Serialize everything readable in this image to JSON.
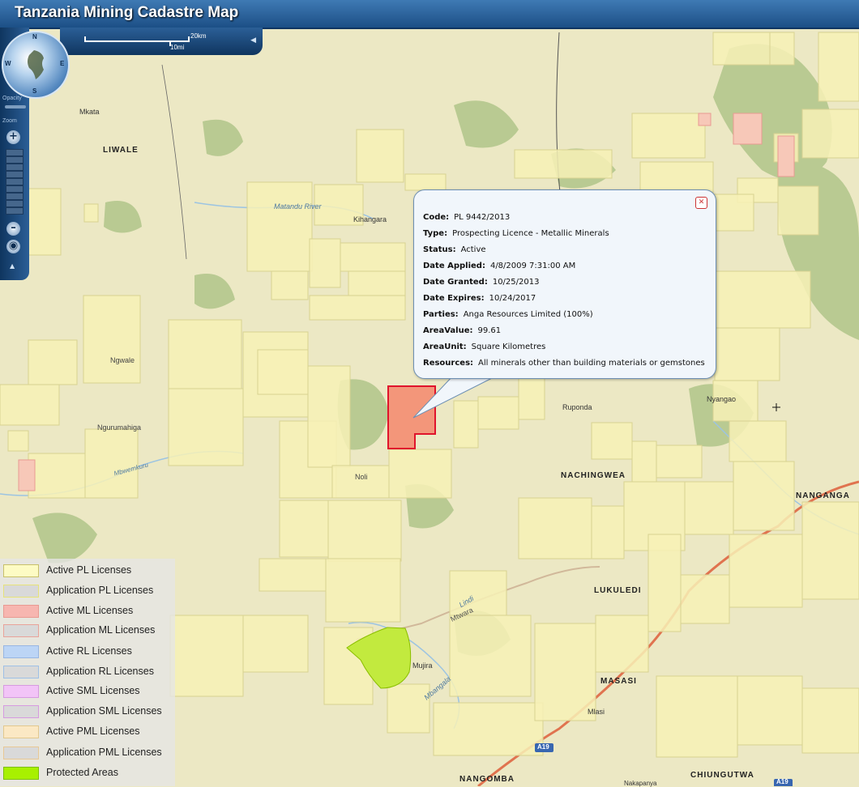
{
  "app": {
    "title": "Tanzania Mining Cadastre Map"
  },
  "scalebar": {
    "km_label": "20km",
    "mi_label": "10mi"
  },
  "nav": {
    "north": "N",
    "south": "S",
    "east": "E",
    "west": "W",
    "opacity_label": "Opacity",
    "zoom_label": "Zoom",
    "zoom_in": "+",
    "zoom_out": "–"
  },
  "places": [
    {
      "name": "Mkata",
      "bold": false
    },
    {
      "name": "LIWALE",
      "bold": true
    },
    {
      "name": "Kihangara",
      "bold": false
    },
    {
      "name": "Ngwale",
      "bold": false
    },
    {
      "name": "Ngurumahiga",
      "bold": false
    },
    {
      "name": "Noli",
      "bold": false
    },
    {
      "name": "Ruponda",
      "bold": false
    },
    {
      "name": "NACHINGWEA",
      "bold": true
    },
    {
      "name": "NANGANGA",
      "bold": true
    },
    {
      "name": "LUKULEDI",
      "bold": true
    },
    {
      "name": "MASASI",
      "bold": true
    },
    {
      "name": "Mlasi",
      "bold": false
    },
    {
      "name": "Mujira",
      "bold": false
    },
    {
      "name": "Nyangao",
      "bold": false
    },
    {
      "name": "NANGOMBA",
      "bold": true
    },
    {
      "name": "CHIUNGUTWA",
      "bold": true
    },
    {
      "name": "Lindi",
      "bold": false
    },
    {
      "name": "Mtwara",
      "bold": false
    },
    {
      "name": "Mbangala",
      "bold": false
    },
    {
      "name": "Mbwemkuru",
      "bold": false
    },
    {
      "name": "Matandu River",
      "bold": false
    },
    {
      "name": "Nakapanya",
      "bold": false
    },
    {
      "name": "A19",
      "bold": false
    },
    {
      "name": "A19",
      "bold": false
    }
  ],
  "popup": {
    "fields": [
      {
        "label": "Code:",
        "value": "PL 9442/2013"
      },
      {
        "label": "Type:",
        "value": "Prospecting Licence - Metallic Minerals"
      },
      {
        "label": "Status:",
        "value": "Active"
      },
      {
        "label": "Date Applied:",
        "value": "4/8/2009 7:31:00 AM"
      },
      {
        "label": "Date Granted:",
        "value": "10/25/2013"
      },
      {
        "label": "Date Expires:",
        "value": "10/24/2017"
      },
      {
        "label": "Parties:",
        "value": "Anga Resources Limited (100%)"
      },
      {
        "label": "AreaValue:",
        "value": "99.61"
      },
      {
        "label": "AreaUnit:",
        "value": "Square Kilometres"
      },
      {
        "label": "Resources:",
        "value": "All minerals other than building materials or gemstones"
      }
    ]
  },
  "legend": [
    {
      "label": "Active PL Licenses",
      "fill": "#fdfbc4",
      "stroke": "#c8c06a"
    },
    {
      "label": "Application PL Licenses",
      "fill": "#d9d9d9",
      "stroke": "#e6e27a"
    },
    {
      "label": "Active ML Licenses",
      "fill": "#f7b6b0",
      "stroke": "#e99a92"
    },
    {
      "label": "Application ML Licenses",
      "fill": "#d9d9d9",
      "stroke": "#e9a39a"
    },
    {
      "label": "Active RL Licenses",
      "fill": "#bcd5f5",
      "stroke": "#98b6e2"
    },
    {
      "label": "Application RL Licenses",
      "fill": "#d9d9d9",
      "stroke": "#9fc0e6"
    },
    {
      "label": "Active SML Licenses",
      "fill": "#f2c4f7",
      "stroke": "#d69be0"
    },
    {
      "label": "Application SML Licenses",
      "fill": "#d9d9d9",
      "stroke": "#d69be0"
    },
    {
      "label": "Active PML Licenses",
      "fill": "#fbe8c4",
      "stroke": "#e2c88f"
    },
    {
      "label": "Application PML Licenses",
      "fill": "#d9d9d9",
      "stroke": "#e8c895"
    },
    {
      "label": "Protected Areas",
      "fill": "#a8f000",
      "stroke": "#7cc000"
    }
  ],
  "colors": {
    "base_map": "#ece8c4",
    "parcel_fill": "#f7f1b6",
    "parcel_stroke": "#d8d291",
    "selected_fill": "#f48d72",
    "selected_stroke": "#e0142c",
    "protected": "#c2ea3e",
    "road": "#e0734f",
    "forest": "#a4bf7c"
  }
}
